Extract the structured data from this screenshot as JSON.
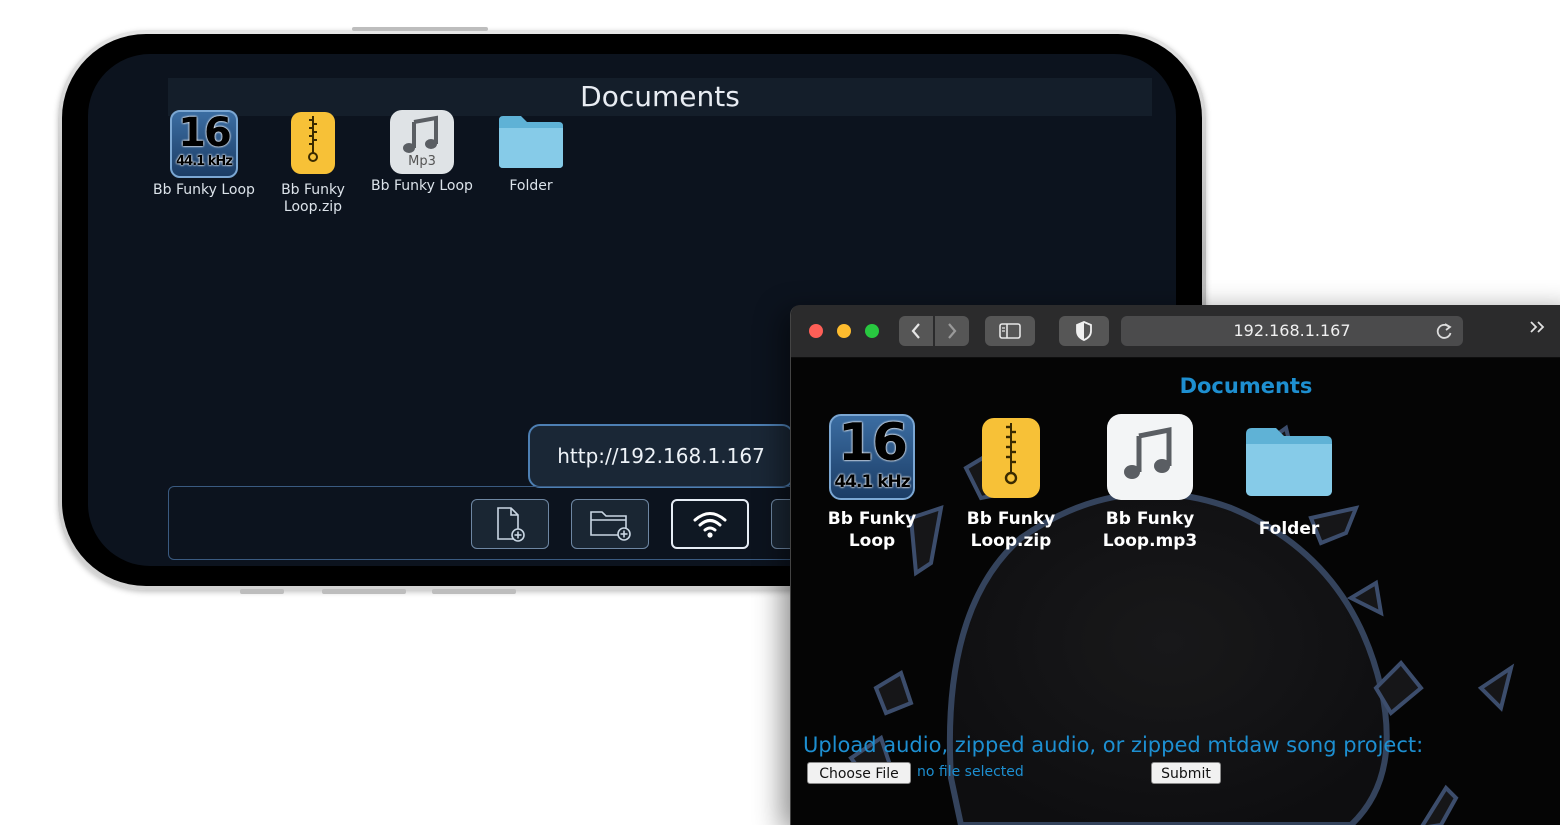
{
  "phone": {
    "title": "Documents",
    "files": [
      {
        "label": "Bb Funky Loop",
        "icon": "audio-16bit-icon",
        "badge_big": "16",
        "badge_small": "44.1 kHz"
      },
      {
        "label": "Bb Funky Loop.zip",
        "icon": "zip-file-icon"
      },
      {
        "label": "Bb Funky Loop",
        "icon": "mp3-file-icon",
        "caption": "Mp3"
      },
      {
        "label": "Folder",
        "icon": "folder-icon"
      }
    ],
    "url_popup": "http://192.168.1.167",
    "toolbar": [
      {
        "name": "new-file-button",
        "icon": "new-file-icon"
      },
      {
        "name": "new-folder-button",
        "icon": "new-folder-icon"
      },
      {
        "name": "wifi-share-button",
        "icon": "wifi-icon",
        "active": true
      },
      {
        "name": "settings-button",
        "icon": "gear-icon"
      }
    ]
  },
  "browser": {
    "address": "192.168.1.167",
    "title": "Documents",
    "files": [
      {
        "label": "Bb Funky Loop",
        "icon": "audio-16bit-icon",
        "badge_big": "16",
        "badge_small": "44.1 kHz"
      },
      {
        "label": "Bb Funky Loop.zip",
        "icon": "zip-file-icon"
      },
      {
        "label": "Bb Funky Loop.mp3",
        "icon": "mp3-file-icon"
      },
      {
        "label": "Folder",
        "icon": "folder-icon"
      }
    ],
    "upload_label": "Upload audio, zipped audio, or zipped mtdaw song project:",
    "choose_file": "Choose File",
    "no_file": "no file selected",
    "submit": "Submit"
  },
  "colors": {
    "phone_bg": "#0c131e",
    "accent_blue": "#1e8fd0",
    "zip_yellow": "#f7c137",
    "folder_blue": "#7cc6e4"
  }
}
